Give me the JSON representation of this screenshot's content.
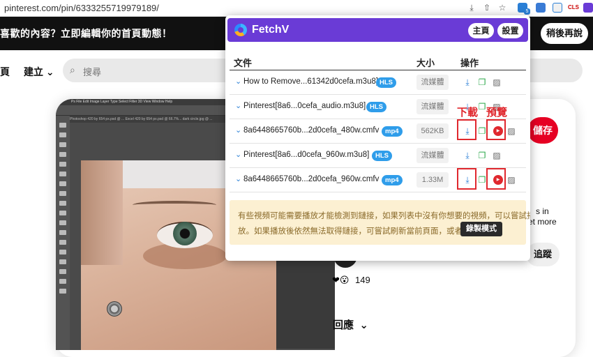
{
  "browser": {
    "url": "pinterest.com/pin/6333255719979189/",
    "ext_labels": [
      "5",
      "CLS"
    ]
  },
  "pinterest": {
    "banner_text": "喜歡的內容？立即編輯你的首頁動態！",
    "later_label": "稍後再說",
    "nav_home": "頁",
    "nav_create": "建立",
    "search_placeholder": "搜尋",
    "save_label": "儲存",
    "side_snippet_1": "s in",
    "side_snippet_2": "et more",
    "follow_label": "追蹤",
    "reaction_emojis": "❤😮",
    "reaction_count": "149",
    "comments_label": "回應"
  },
  "photoshop": {
    "menu": "Ps   File   Edit   Image   Layer   Type   Select   Filter   3D   View   Window   Help",
    "tabs": "Photoshop 420 by 654 px.psd @ ...   Excel 420 by 654 px.psd @ 66.7%...   dark circle.jpg @ ..."
  },
  "fetchv": {
    "title": "FetchV",
    "home_label": "主頁",
    "settings_label": "設置",
    "col_file": "文件",
    "col_size": "大小",
    "col_action": "操作",
    "rows": [
      {
        "name": "How to Remove...61342d0cefa.m3u8]",
        "badge": "HLS",
        "size": "流媒體"
      },
      {
        "name": "Pinterest[8a6...0cefa_audio.m3u8]",
        "badge": "HLS",
        "size": "流媒體"
      },
      {
        "name": "8a6448665760b...2d0cefa_480w.cmfv",
        "badge": "mp4",
        "size": "562KB"
      },
      {
        "name": "Pinterest[8a6...d0cefa_960w.m3u8]",
        "badge": "HLS",
        "size": "流媒體"
      },
      {
        "name": "8a6448665760b...2d0cefa_960w.cmfv",
        "badge": "mp4",
        "size": "1.33M"
      }
    ],
    "notice_line1": "有些視頻可能需要播放才能檢測到鏈接，如果列表中沒有你想要的視頻，可以嘗試播",
    "notice_line2": "放。如果播放後依然無法取得鏈接，可嘗試刷新當前頁面，或者使用",
    "record_mode": "錄製模式",
    "colors": {
      "header": "#6a3bd6",
      "badge": "#2f9dea",
      "notice_bg": "#fcf0d2"
    }
  },
  "annotations": {
    "download": "下載",
    "preview": "預覽",
    "color": "#e0282e"
  },
  "icons": [
    "download-icon",
    "copy-icon",
    "camera-off-icon",
    "play-icon",
    "chevron-down-icon",
    "search-icon",
    "share-icon",
    "star-icon"
  ]
}
